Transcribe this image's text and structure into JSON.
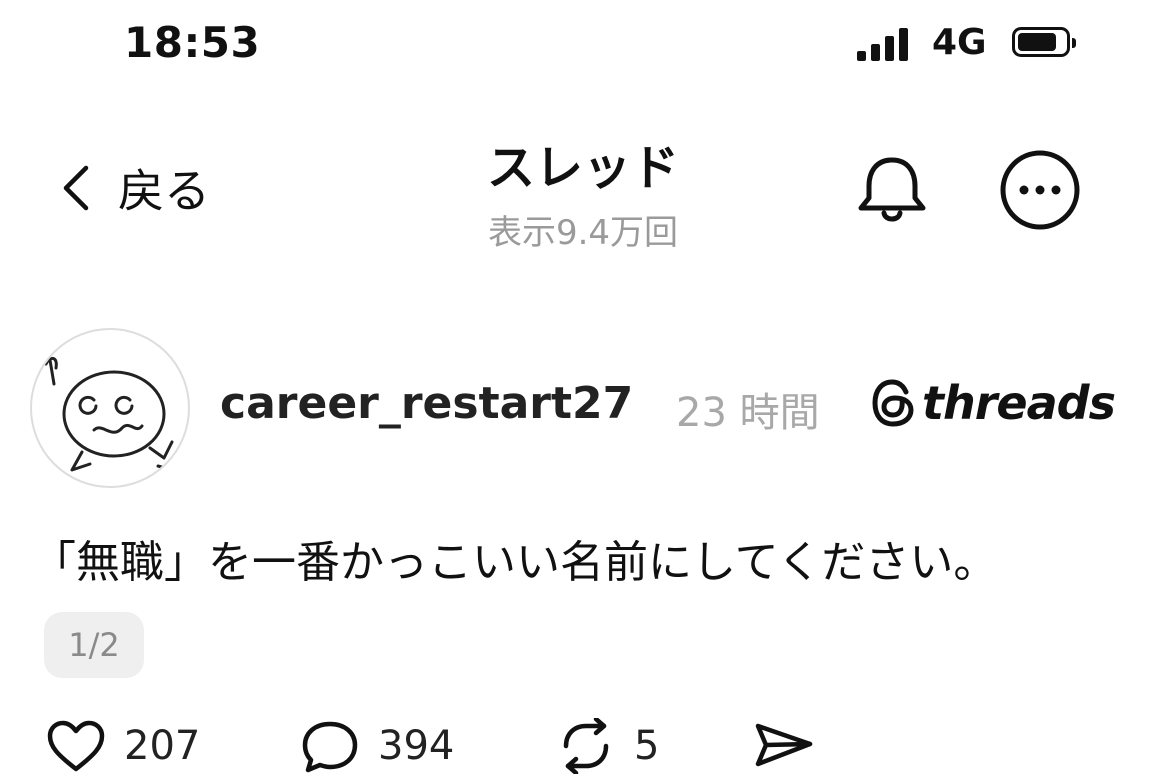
{
  "status_bar": {
    "time": "18:53",
    "network": "4G"
  },
  "nav": {
    "back_label": "戻る",
    "title": "スレッド",
    "subtitle": "表示9.4万回"
  },
  "post": {
    "username": "career_restart27",
    "time_ago": "23 時間",
    "brand": "threads",
    "text": "「無職」を一番かっこいい名前にしてください。",
    "page_indicator": "1/2",
    "likes": "207",
    "replies": "394",
    "reposts": "5"
  },
  "icons": {
    "back": "chevron-left-icon",
    "notifications": "bell-icon",
    "more": "more-horizontal-icon",
    "like": "heart-icon",
    "reply": "comment-icon",
    "repost": "repost-icon",
    "share": "send-icon"
  }
}
